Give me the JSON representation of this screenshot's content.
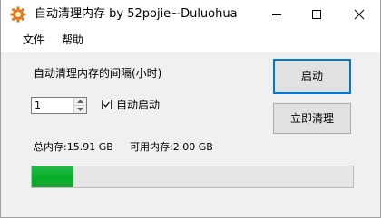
{
  "window": {
    "title": "自动清理内存 by 52pojie~Duluohua",
    "controls": [
      "minimize-icon",
      "maximize-icon",
      "close-icon"
    ],
    "app_icon": "gear-icon"
  },
  "menu": {
    "items": [
      "文件",
      "帮助"
    ]
  },
  "main": {
    "interval_label": "自动清理内存的间隔(小时)",
    "interval_value": "1",
    "autostart_label": "自动启动",
    "autostart_checked": true,
    "start_button": "启动",
    "clean_button": "立即清理",
    "total_memory": "总内存:15.91 GB",
    "free_memory": "可用内存:2.00 GB",
    "memory_progress": 0.13
  },
  "colors": {
    "accent": "#0078d7",
    "progress": "#06b025",
    "app_icon": "#e07b20"
  }
}
